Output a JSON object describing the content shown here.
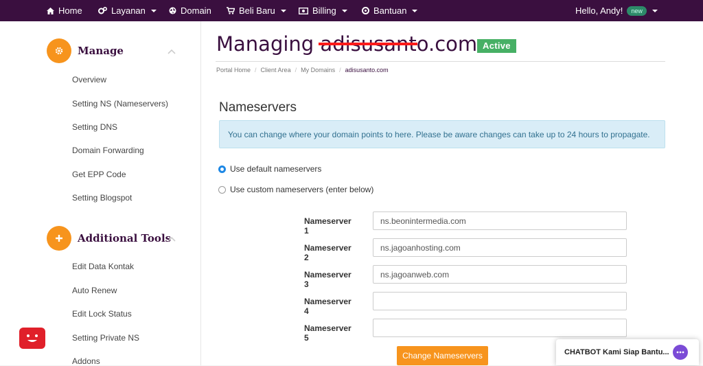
{
  "navbar": {
    "items": [
      {
        "label": "Home",
        "icon": "home-icon"
      },
      {
        "label": "Layanan",
        "icon": "gears-icon"
      },
      {
        "label": "Domain",
        "icon": "globe-icon"
      },
      {
        "label": "Beli Baru",
        "icon": "cart-icon"
      },
      {
        "label": "Billing",
        "icon": "billing-icon"
      },
      {
        "label": "Bantuan",
        "icon": "lifebuoy-icon"
      }
    ],
    "user_greeting": "Hello, Andy!",
    "user_badge": "new"
  },
  "sidebar": {
    "manage_title": "Manage",
    "manage_items": [
      "Overview",
      "Setting NS (Nameservers)",
      "Setting DNS",
      "Domain Forwarding",
      "Get EPP Code",
      "Setting Blogspot"
    ],
    "tools_title": "Additional Tools",
    "tools_items": [
      "Edit Data Kontak",
      "Auto Renew",
      "Edit Lock Status",
      "Setting Private NS",
      "Addons"
    ]
  },
  "main": {
    "title_prefix": "Managing ",
    "title_domain": "adisusanto.com",
    "status": "Active",
    "breadcrumb": [
      "Portal Home",
      "Client Area",
      "My Domains",
      "adisusanto.com"
    ],
    "section_title": "Nameservers",
    "info_text": "You can change where your domain points to here. Please be aware changes can take up to 24 hours to propagate.",
    "radio_default": "Use default nameservers",
    "radio_custom": "Use custom nameservers (enter below)",
    "nameservers": [
      {
        "label": "Nameserver 1",
        "value": "ns.beonintermedia.com"
      },
      {
        "label": "Nameserver 2",
        "value": "ns.jagoanhosting.com"
      },
      {
        "label": "Nameserver 3",
        "value": "ns.jagoanweb.com"
      },
      {
        "label": "Nameserver 4",
        "value": ""
      },
      {
        "label": "Nameserver 5",
        "value": ""
      }
    ],
    "submit_label": "Change Nameservers"
  },
  "chatbot": {
    "label": "CHATBOT Kami Siap Bantu..."
  },
  "colors": {
    "brand": "#3a0f3f",
    "accent": "#f7941d",
    "active": "#47b065",
    "info_bg": "#d9edf7"
  }
}
